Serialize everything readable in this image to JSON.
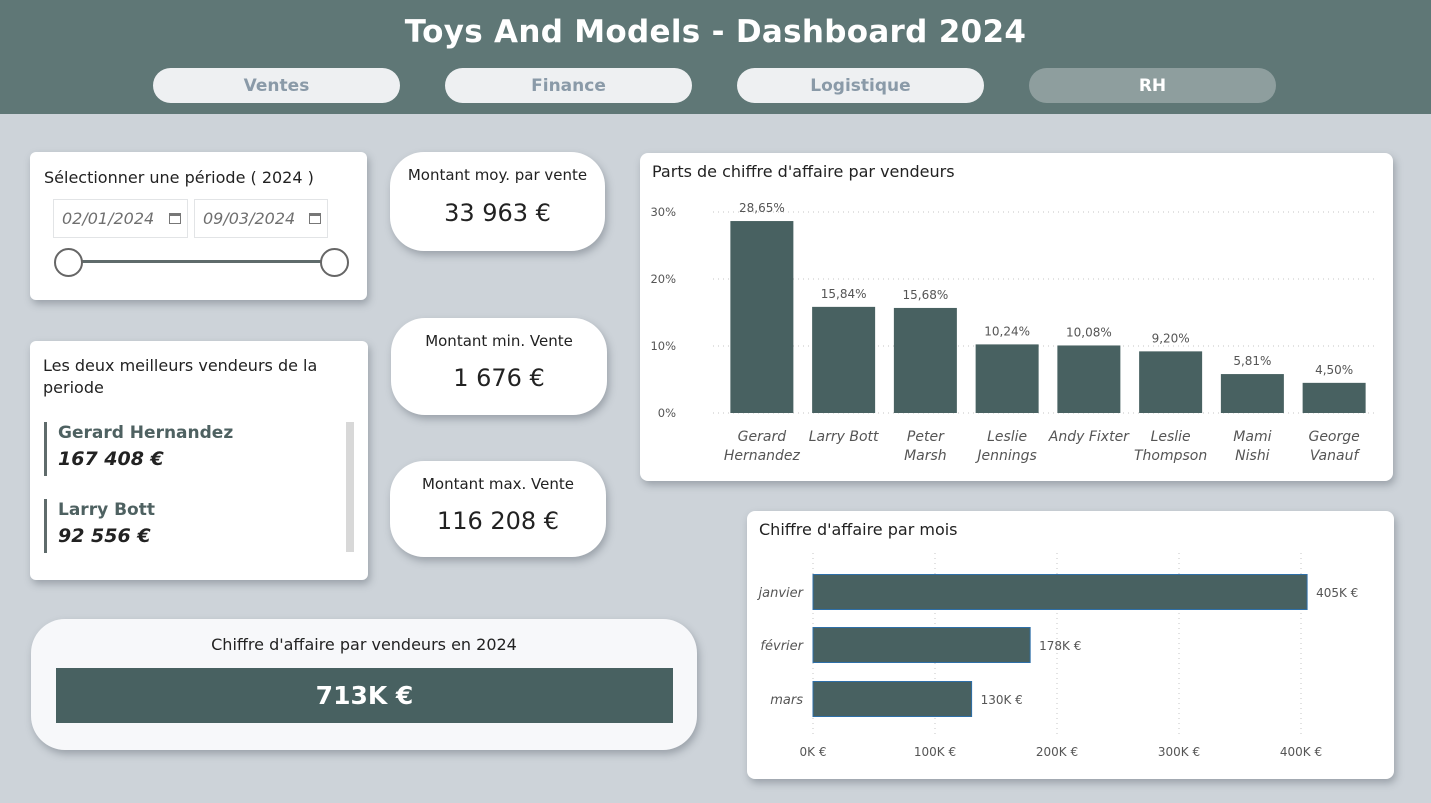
{
  "header": {
    "title": "Toys And Models - Dashboard 2024",
    "tabs": [
      {
        "label": "Ventes",
        "active": false
      },
      {
        "label": "Finance",
        "active": false
      },
      {
        "label": "Logistique",
        "active": false
      },
      {
        "label": "RH",
        "active": true
      }
    ]
  },
  "colors": {
    "header_bg": "#5f7776",
    "bar": "#486161",
    "page_bg": "#cdd3d9",
    "accent_text": "#4e6161"
  },
  "period": {
    "label": "Sélectionner une période ( 2024 )",
    "start_date": "02/01/2024",
    "end_date": "09/03/2024",
    "icon": "calendar-icon"
  },
  "kpis": {
    "avg": {
      "label": "Montant moy. par vente",
      "value": "33 963 €"
    },
    "min": {
      "label": "Montant min. Vente",
      "value": "1 676 €"
    },
    "max": {
      "label": "Montant max. Vente",
      "value": "116 208 €"
    }
  },
  "top_sellers": {
    "label": "Les deux meilleurs vendeurs de la periode",
    "items": [
      {
        "name": "Gerard Hernandez",
        "amount": "167 408 €"
      },
      {
        "name": "Larry Bott",
        "amount": "92 556 €"
      }
    ]
  },
  "total": {
    "label": "Chiffre d'affaire par vendeurs en 2024",
    "value": "713K €"
  },
  "chart_data": [
    {
      "type": "bar",
      "title": "Parts de chiffre d'affaire par vendeurs",
      "categories": [
        [
          "Gerard",
          "Hernandez"
        ],
        [
          "Larry Bott"
        ],
        [
          "Peter",
          "Marsh"
        ],
        [
          "Leslie",
          "Jennings"
        ],
        [
          "Andy Fixter"
        ],
        [
          "Leslie",
          "Thompson"
        ],
        [
          "Mami",
          "Nishi"
        ],
        [
          "George",
          "Vanauf"
        ]
      ],
      "values": [
        28.65,
        15.84,
        15.68,
        10.24,
        10.08,
        9.2,
        5.81,
        4.5
      ],
      "data_labels": [
        "28,65%",
        "15,84%",
        "15,68%",
        "10,24%",
        "10,08%",
        "9,20%",
        "5,81%",
        "4,50%"
      ],
      "y_ticks": [
        "0%",
        "10%",
        "20%",
        "30%"
      ],
      "ylim": [
        0,
        30
      ],
      "grid": true
    },
    {
      "type": "bar",
      "orientation": "horizontal",
      "title": "Chiffre d'affaire par mois",
      "categories": [
        "janvier",
        "février",
        "mars"
      ],
      "values": [
        405,
        178,
        130
      ],
      "data_labels": [
        "405K €",
        "178K €",
        "130K €"
      ],
      "x_ticks": [
        "0K €",
        "100K €",
        "200K €",
        "300K €",
        "400K €"
      ],
      "xlim": [
        0,
        400
      ],
      "grid": true
    }
  ]
}
